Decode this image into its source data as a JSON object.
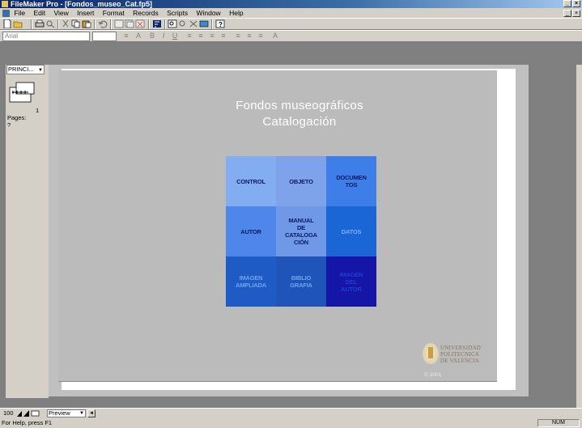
{
  "window": {
    "title": "FileMaker Pro - [Fondos_museo_Cat.fp5]",
    "controls": [
      "_",
      "×"
    ]
  },
  "menu": {
    "items": [
      "File",
      "Edit",
      "View",
      "Insert",
      "Format",
      "Records",
      "Scripts",
      "Window",
      "Help"
    ]
  },
  "format_bar": {
    "font_name": "Arial",
    "font_size": ""
  },
  "left_panel": {
    "layout": "PRINCI...",
    "page_number": "1",
    "pages_label": "Pages:",
    "pages_value": "?"
  },
  "document": {
    "title_line1": "Fondos museográficos",
    "title_line2": "Catalogación",
    "grid": [
      {
        "label": "CONTROL",
        "bg": "#82adf1",
        "fg": "#0b1a66"
      },
      {
        "label": "OBJETO",
        "bg": "#7ea3ea",
        "fg": "#0b1a66"
      },
      {
        "label": "DOCUMEN\nTOS",
        "bg": "#3e7ee8",
        "fg": "#0b1a66"
      },
      {
        "label": "AUTOR",
        "bg": "#4f86ea",
        "fg": "#0b1a66"
      },
      {
        "label": "MANUAL\nDE\nCATALOGA\nCIÓN",
        "bg": "#6f99e6",
        "fg": "#0b1a66"
      },
      {
        "label": "DATOS",
        "bg": "#1a66d6",
        "fg": "#7fb0ff"
      },
      {
        "label": "IMAGEN\nAMPLIADA",
        "bg": "#1f5bc4",
        "fg": "#6ea3f2"
      },
      {
        "label": "BIBLIO\nGRAFIA",
        "bg": "#1f55b8",
        "fg": "#6ea3f2"
      },
      {
        "label": "IMAGEN\nDEL\nAUTOR",
        "bg": "#1515a8",
        "fg": "#1f3fd0"
      }
    ],
    "logo_lines": [
      "UNIVERSIDAD",
      "POLITECNICA",
      "DE VALENCIA"
    ],
    "copyright": "© 2001"
  },
  "bottom": {
    "zoom": "100",
    "mode": "Preview"
  },
  "status": {
    "text": "For Help, press F1",
    "num": "NUM"
  },
  "colors": {
    "accent": "#0a246a",
    "chrome": "#d4d0c8",
    "workspace": "#808080",
    "page_bg": "#bbbbbb"
  },
  "icons": [
    "new-icon",
    "open-icon",
    "print-icon",
    "preview-icon",
    "cut-icon",
    "copy-icon",
    "paste-icon",
    "undo-icon",
    "sort-icon",
    "find-icon",
    "help-icon"
  ]
}
